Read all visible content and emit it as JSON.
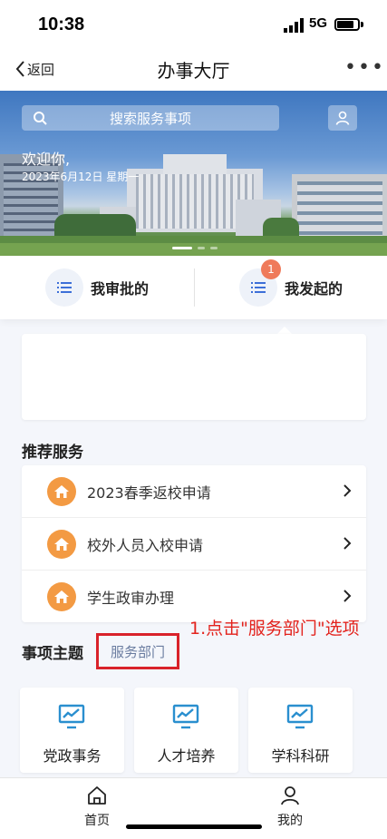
{
  "status_bar": {
    "time": "10:38",
    "network": "5G"
  },
  "nav": {
    "back_label": "返回",
    "title": "办事大厅",
    "more": "•••"
  },
  "banner": {
    "search_placeholder": "搜索服务事项",
    "welcome": "欢迎你,",
    "date": "2023年6月12日 星期一"
  },
  "approvals": {
    "mine": "我审批的",
    "initiated": "我发起的",
    "initiated_badge": "1"
  },
  "recommended": {
    "title": "推荐服务",
    "items": [
      {
        "label": "2023春季返校申请"
      },
      {
        "label": "校外人员入校申请"
      },
      {
        "label": "学生政审办理"
      }
    ]
  },
  "annotation": "1.点击\"服务部门\"选项",
  "topics": {
    "title": "事项主题",
    "dept_tab": "服务部门",
    "tiles": [
      {
        "label": "党政事务"
      },
      {
        "label": "人才培养"
      },
      {
        "label": "学科科研"
      }
    ]
  },
  "tabbar": {
    "home": "首页",
    "mine": "我的"
  },
  "colors": {
    "accent_orange": "#f39a43",
    "annotation_red": "#e3231d",
    "badge": "#ef7a5a",
    "icon_blue": "#2a8fcf"
  }
}
